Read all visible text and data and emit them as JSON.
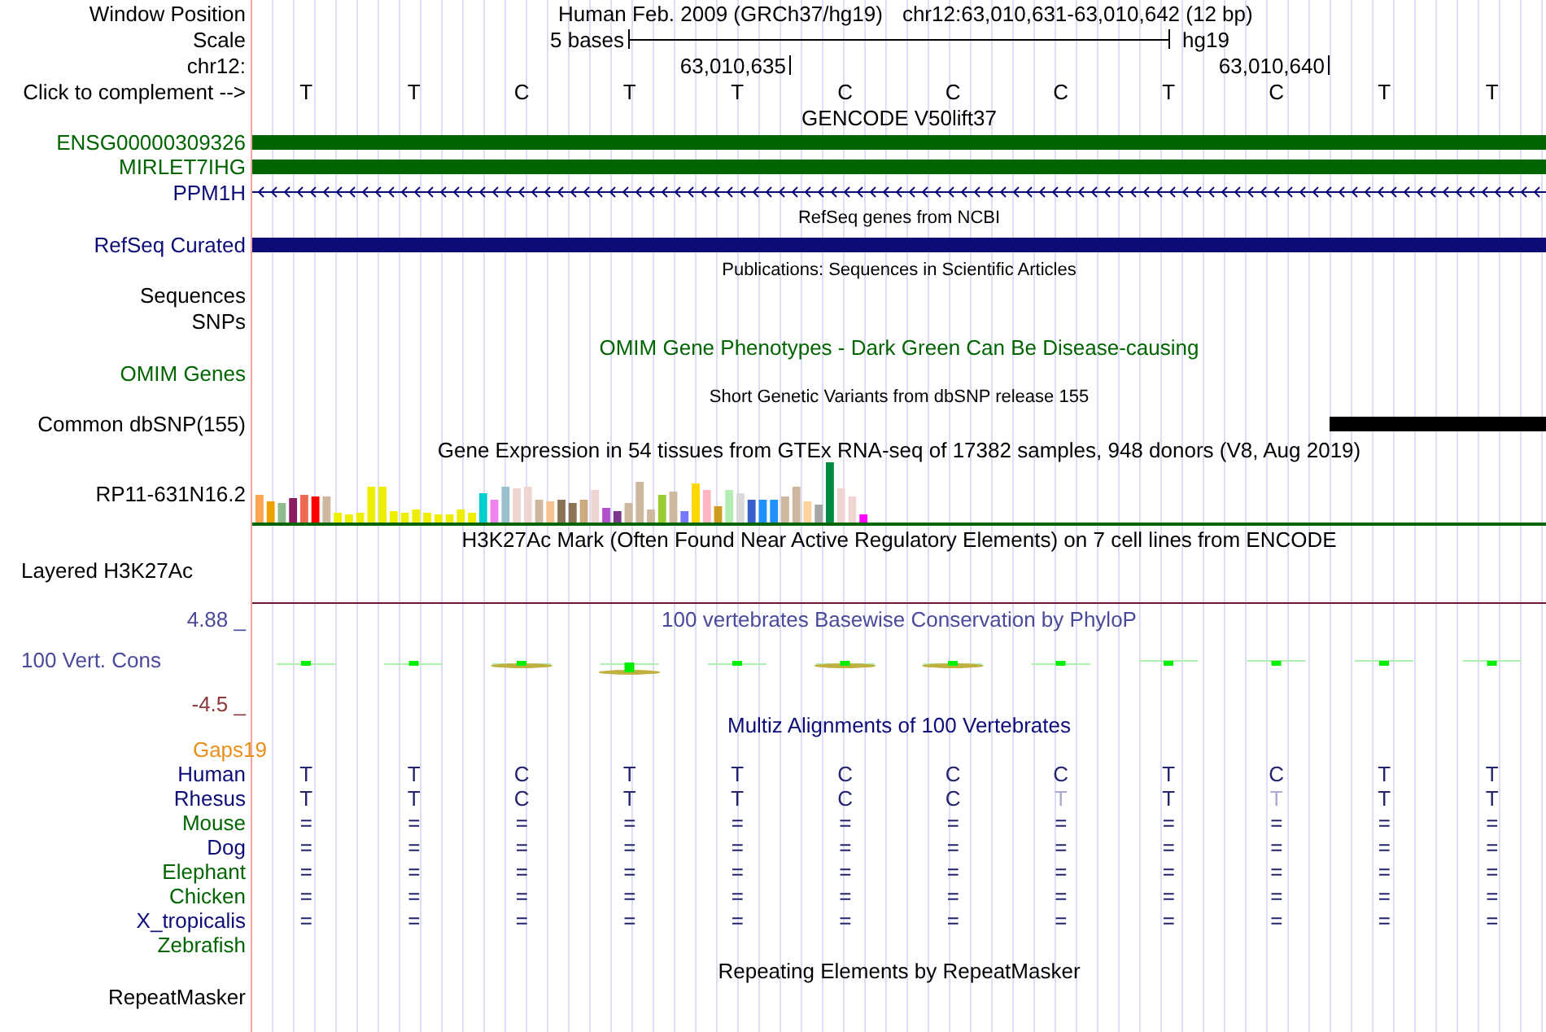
{
  "header": {
    "window_position_label": "Window Position",
    "assembly": "Human Feb. 2009 (GRCh37/hg19)",
    "position": "chr12:63,010,631-63,010,642 (12 bp)",
    "scale_label": "Scale",
    "scale_text": "5 bases",
    "scale_db": "hg19",
    "chrom_label": "chr12:",
    "coord_ticks": [
      "63,010,635",
      "63,010,640"
    ],
    "complement_label": "Click to complement -->",
    "bases": [
      "T",
      "T",
      "C",
      "T",
      "T",
      "C",
      "C",
      "C",
      "T",
      "C",
      "T",
      "T"
    ]
  },
  "gene_tracks": {
    "title": "GENCODE V50lift37",
    "genes": [
      {
        "label": "ENSG00000309326",
        "kind": "bar",
        "color": "#006400"
      },
      {
        "label": "MIRLET7IHG",
        "kind": "bar",
        "color": "#006400"
      },
      {
        "label": "PPM1H",
        "kind": "strand",
        "color": "#0c0c78"
      }
    ]
  },
  "refseq": {
    "title": "RefSeq genes from NCBI",
    "label": "RefSeq Curated"
  },
  "publications": {
    "title": "Publications: Sequences in Scientific Articles",
    "labels": [
      "Sequences",
      "SNPs"
    ]
  },
  "omim": {
    "title": "OMIM Gene Phenotypes - Dark Green Can Be Disease-causing",
    "label": "OMIM Genes"
  },
  "dbsnp": {
    "title": "Short Genetic Variants from dbSNP release 155",
    "label": "Common dbSNP(155)"
  },
  "gtex": {
    "title": "Gene Expression in 54 tissues from GTEx RNA-seq of 17382 samples, 948 donors (V8, Aug 2019)",
    "label": "RP11-631N16.2"
  },
  "h3k27ac": {
    "title": "H3K27Ac Mark (Often Found Near Active Regulatory Elements) on 7 cell lines from ENCODE",
    "label": "Layered H3K27Ac"
  },
  "phylop": {
    "title": "100 vertebrates Basewise Conservation by PhyloP",
    "label": "100 Vert. Cons",
    "max": "4.88 _",
    "min": "-4.5 _"
  },
  "multiz": {
    "title": "Multiz Alignments of 100 Vertebrates",
    "gaps_label": "Gaps19",
    "species": [
      {
        "name": "Human",
        "color": "#0c0c78",
        "bases": [
          {
            "text": "T",
            "dim": false
          },
          {
            "text": "T",
            "dim": false
          },
          {
            "text": "C",
            "dim": false
          },
          {
            "text": "T",
            "dim": false
          },
          {
            "text": "T",
            "dim": false
          },
          {
            "text": "C",
            "dim": false
          },
          {
            "text": "C",
            "dim": false
          },
          {
            "text": "C",
            "dim": false
          },
          {
            "text": "T",
            "dim": false
          },
          {
            "text": "C",
            "dim": false
          },
          {
            "text": "T",
            "dim": false
          },
          {
            "text": "T",
            "dim": false
          }
        ]
      },
      {
        "name": "Rhesus",
        "color": "#0c0c78",
        "bases": [
          {
            "text": "T",
            "dim": false
          },
          {
            "text": "T",
            "dim": false
          },
          {
            "text": "C",
            "dim": false
          },
          {
            "text": "T",
            "dim": false
          },
          {
            "text": "T",
            "dim": false
          },
          {
            "text": "C",
            "dim": false
          },
          {
            "text": "C",
            "dim": false
          },
          {
            "text": "T",
            "dim": true
          },
          {
            "text": "T",
            "dim": false
          },
          {
            "text": "T",
            "dim": true
          },
          {
            "text": "T",
            "dim": false
          },
          {
            "text": "T",
            "dim": false
          }
        ]
      },
      {
        "name": "Mouse",
        "color": "#006400",
        "bases": [
          {
            "text": "=",
            "dim": false
          },
          {
            "text": "=",
            "dim": false
          },
          {
            "text": "=",
            "dim": false
          },
          {
            "text": "=",
            "dim": false
          },
          {
            "text": "=",
            "dim": false
          },
          {
            "text": "=",
            "dim": false
          },
          {
            "text": "=",
            "dim": false
          },
          {
            "text": "=",
            "dim": false
          },
          {
            "text": "=",
            "dim": false
          },
          {
            "text": "=",
            "dim": false
          },
          {
            "text": "=",
            "dim": false
          },
          {
            "text": "=",
            "dim": false
          }
        ]
      },
      {
        "name": "Dog",
        "color": "#0c0c78",
        "bases": [
          {
            "text": "=",
            "dim": false
          },
          {
            "text": "=",
            "dim": false
          },
          {
            "text": "=",
            "dim": false
          },
          {
            "text": "=",
            "dim": false
          },
          {
            "text": "=",
            "dim": false
          },
          {
            "text": "=",
            "dim": false
          },
          {
            "text": "=",
            "dim": false
          },
          {
            "text": "=",
            "dim": false
          },
          {
            "text": "=",
            "dim": false
          },
          {
            "text": "=",
            "dim": false
          },
          {
            "text": "=",
            "dim": false
          },
          {
            "text": "=",
            "dim": false
          }
        ]
      },
      {
        "name": "Elephant",
        "color": "#006400",
        "bases": [
          {
            "text": "=",
            "dim": false
          },
          {
            "text": "=",
            "dim": false
          },
          {
            "text": "=",
            "dim": false
          },
          {
            "text": "=",
            "dim": false
          },
          {
            "text": "=",
            "dim": false
          },
          {
            "text": "=",
            "dim": false
          },
          {
            "text": "=",
            "dim": false
          },
          {
            "text": "=",
            "dim": false
          },
          {
            "text": "=",
            "dim": false
          },
          {
            "text": "=",
            "dim": false
          },
          {
            "text": "=",
            "dim": false
          },
          {
            "text": "=",
            "dim": false
          }
        ]
      },
      {
        "name": "Chicken",
        "color": "#006400",
        "bases": [
          {
            "text": "=",
            "dim": false
          },
          {
            "text": "=",
            "dim": false
          },
          {
            "text": "=",
            "dim": false
          },
          {
            "text": "=",
            "dim": false
          },
          {
            "text": "=",
            "dim": false
          },
          {
            "text": "=",
            "dim": false
          },
          {
            "text": "=",
            "dim": false
          },
          {
            "text": "=",
            "dim": false
          },
          {
            "text": "=",
            "dim": false
          },
          {
            "text": "=",
            "dim": false
          },
          {
            "text": "=",
            "dim": false
          },
          {
            "text": "=",
            "dim": false
          }
        ]
      },
      {
        "name": "X_tropicalis",
        "color": "#0c0c78",
        "bases": [
          {
            "text": "=",
            "dim": false
          },
          {
            "text": "=",
            "dim": false
          },
          {
            "text": "=",
            "dim": false
          },
          {
            "text": "=",
            "dim": false
          },
          {
            "text": "=",
            "dim": false
          },
          {
            "text": "=",
            "dim": false
          },
          {
            "text": "=",
            "dim": false
          },
          {
            "text": "=",
            "dim": false
          },
          {
            "text": "=",
            "dim": false
          },
          {
            "text": "=",
            "dim": false
          },
          {
            "text": "=",
            "dim": false
          },
          {
            "text": "=",
            "dim": false
          }
        ]
      },
      {
        "name": "Zebrafish",
        "color": "#006400"
      }
    ]
  },
  "repeatmasker": {
    "title": "Repeating Elements by RepeatMasker",
    "label": "RepeatMasker"
  }
}
